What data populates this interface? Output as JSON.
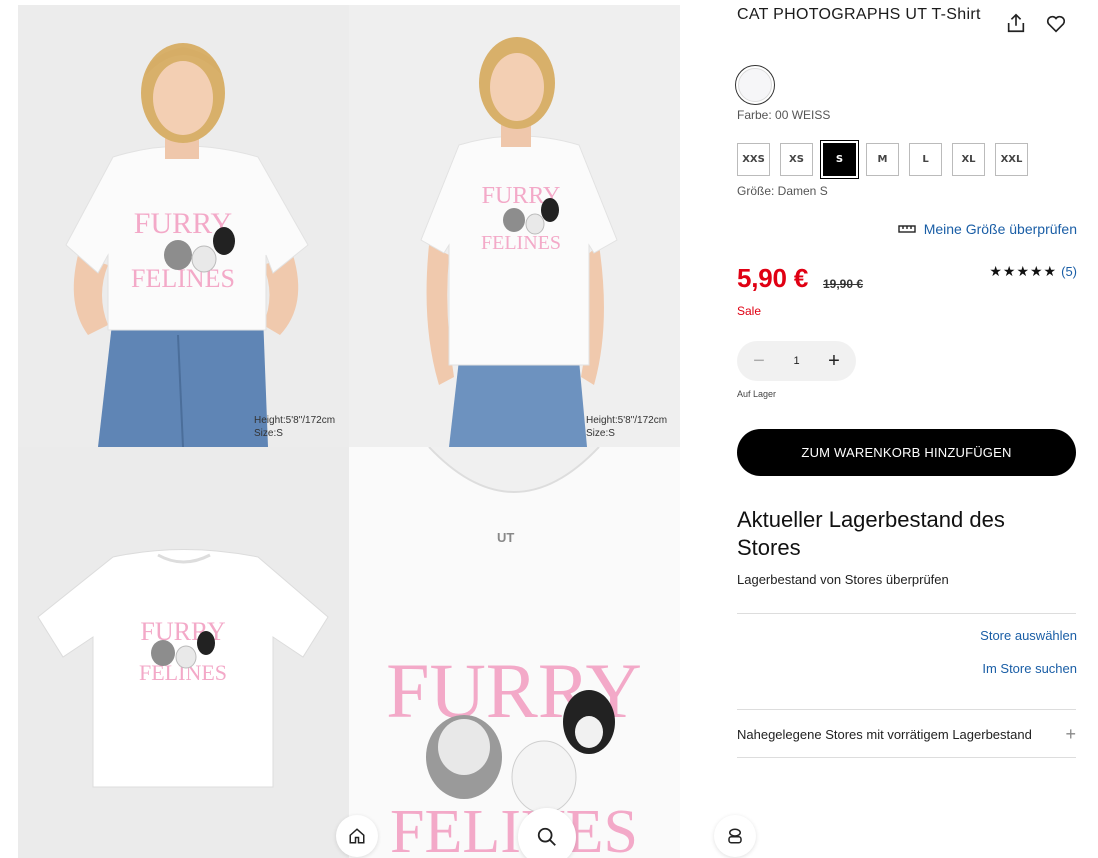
{
  "gallery": {
    "image1": {
      "alt": "model-front",
      "height_text": "Height:5'8\"/172cm",
      "size_text": "Size:S"
    },
    "image2": {
      "alt": "model-front-2",
      "height_text": "Height:5'8\"/172cm",
      "size_text": "Size:S"
    },
    "image3": {
      "alt": "flat-lay"
    },
    "image4": {
      "alt": "print-closeup"
    },
    "print_word1": "FURRY",
    "print_word2": "FELINES",
    "neck_label": "UT"
  },
  "nav": {
    "home_icon": "home-icon",
    "search_icon": "search-icon",
    "user_icon": "user-icon"
  },
  "product": {
    "title": "CAT PHOTOGRAPHS UT T-Shirt",
    "color_label": "Farbe: 00 WEISS",
    "sizes": [
      "XXS",
      "XS",
      "S",
      "M",
      "L",
      "XL",
      "XXL"
    ],
    "selected_size": "S",
    "size_label": "Größe: Damen S",
    "check_size_link": "Meine Größe überprüfen",
    "price": "5,90 €",
    "old_price": "19,90 €",
    "sale_label": "Sale",
    "stars": "★★★★★",
    "rating": 5,
    "review_count": "(5)",
    "quantity": "1",
    "stock_label": "Auf Lager",
    "add_to_cart": "ZUM WARENKORB HINZUFÜGEN"
  },
  "store": {
    "heading": "Aktueller Lagerbestand des Stores",
    "check_stock": "Lagerbestand von Stores überprüfen",
    "select_store": "Store auswählen",
    "search_store": "Im Store suchen",
    "nearby": "Nahegelegene Stores mit vorrätigem Lagerbestand"
  },
  "colors": {
    "price_red": "#e00013",
    "link_blue": "#1a5ea6",
    "print_pink": "#f3a9c8"
  }
}
